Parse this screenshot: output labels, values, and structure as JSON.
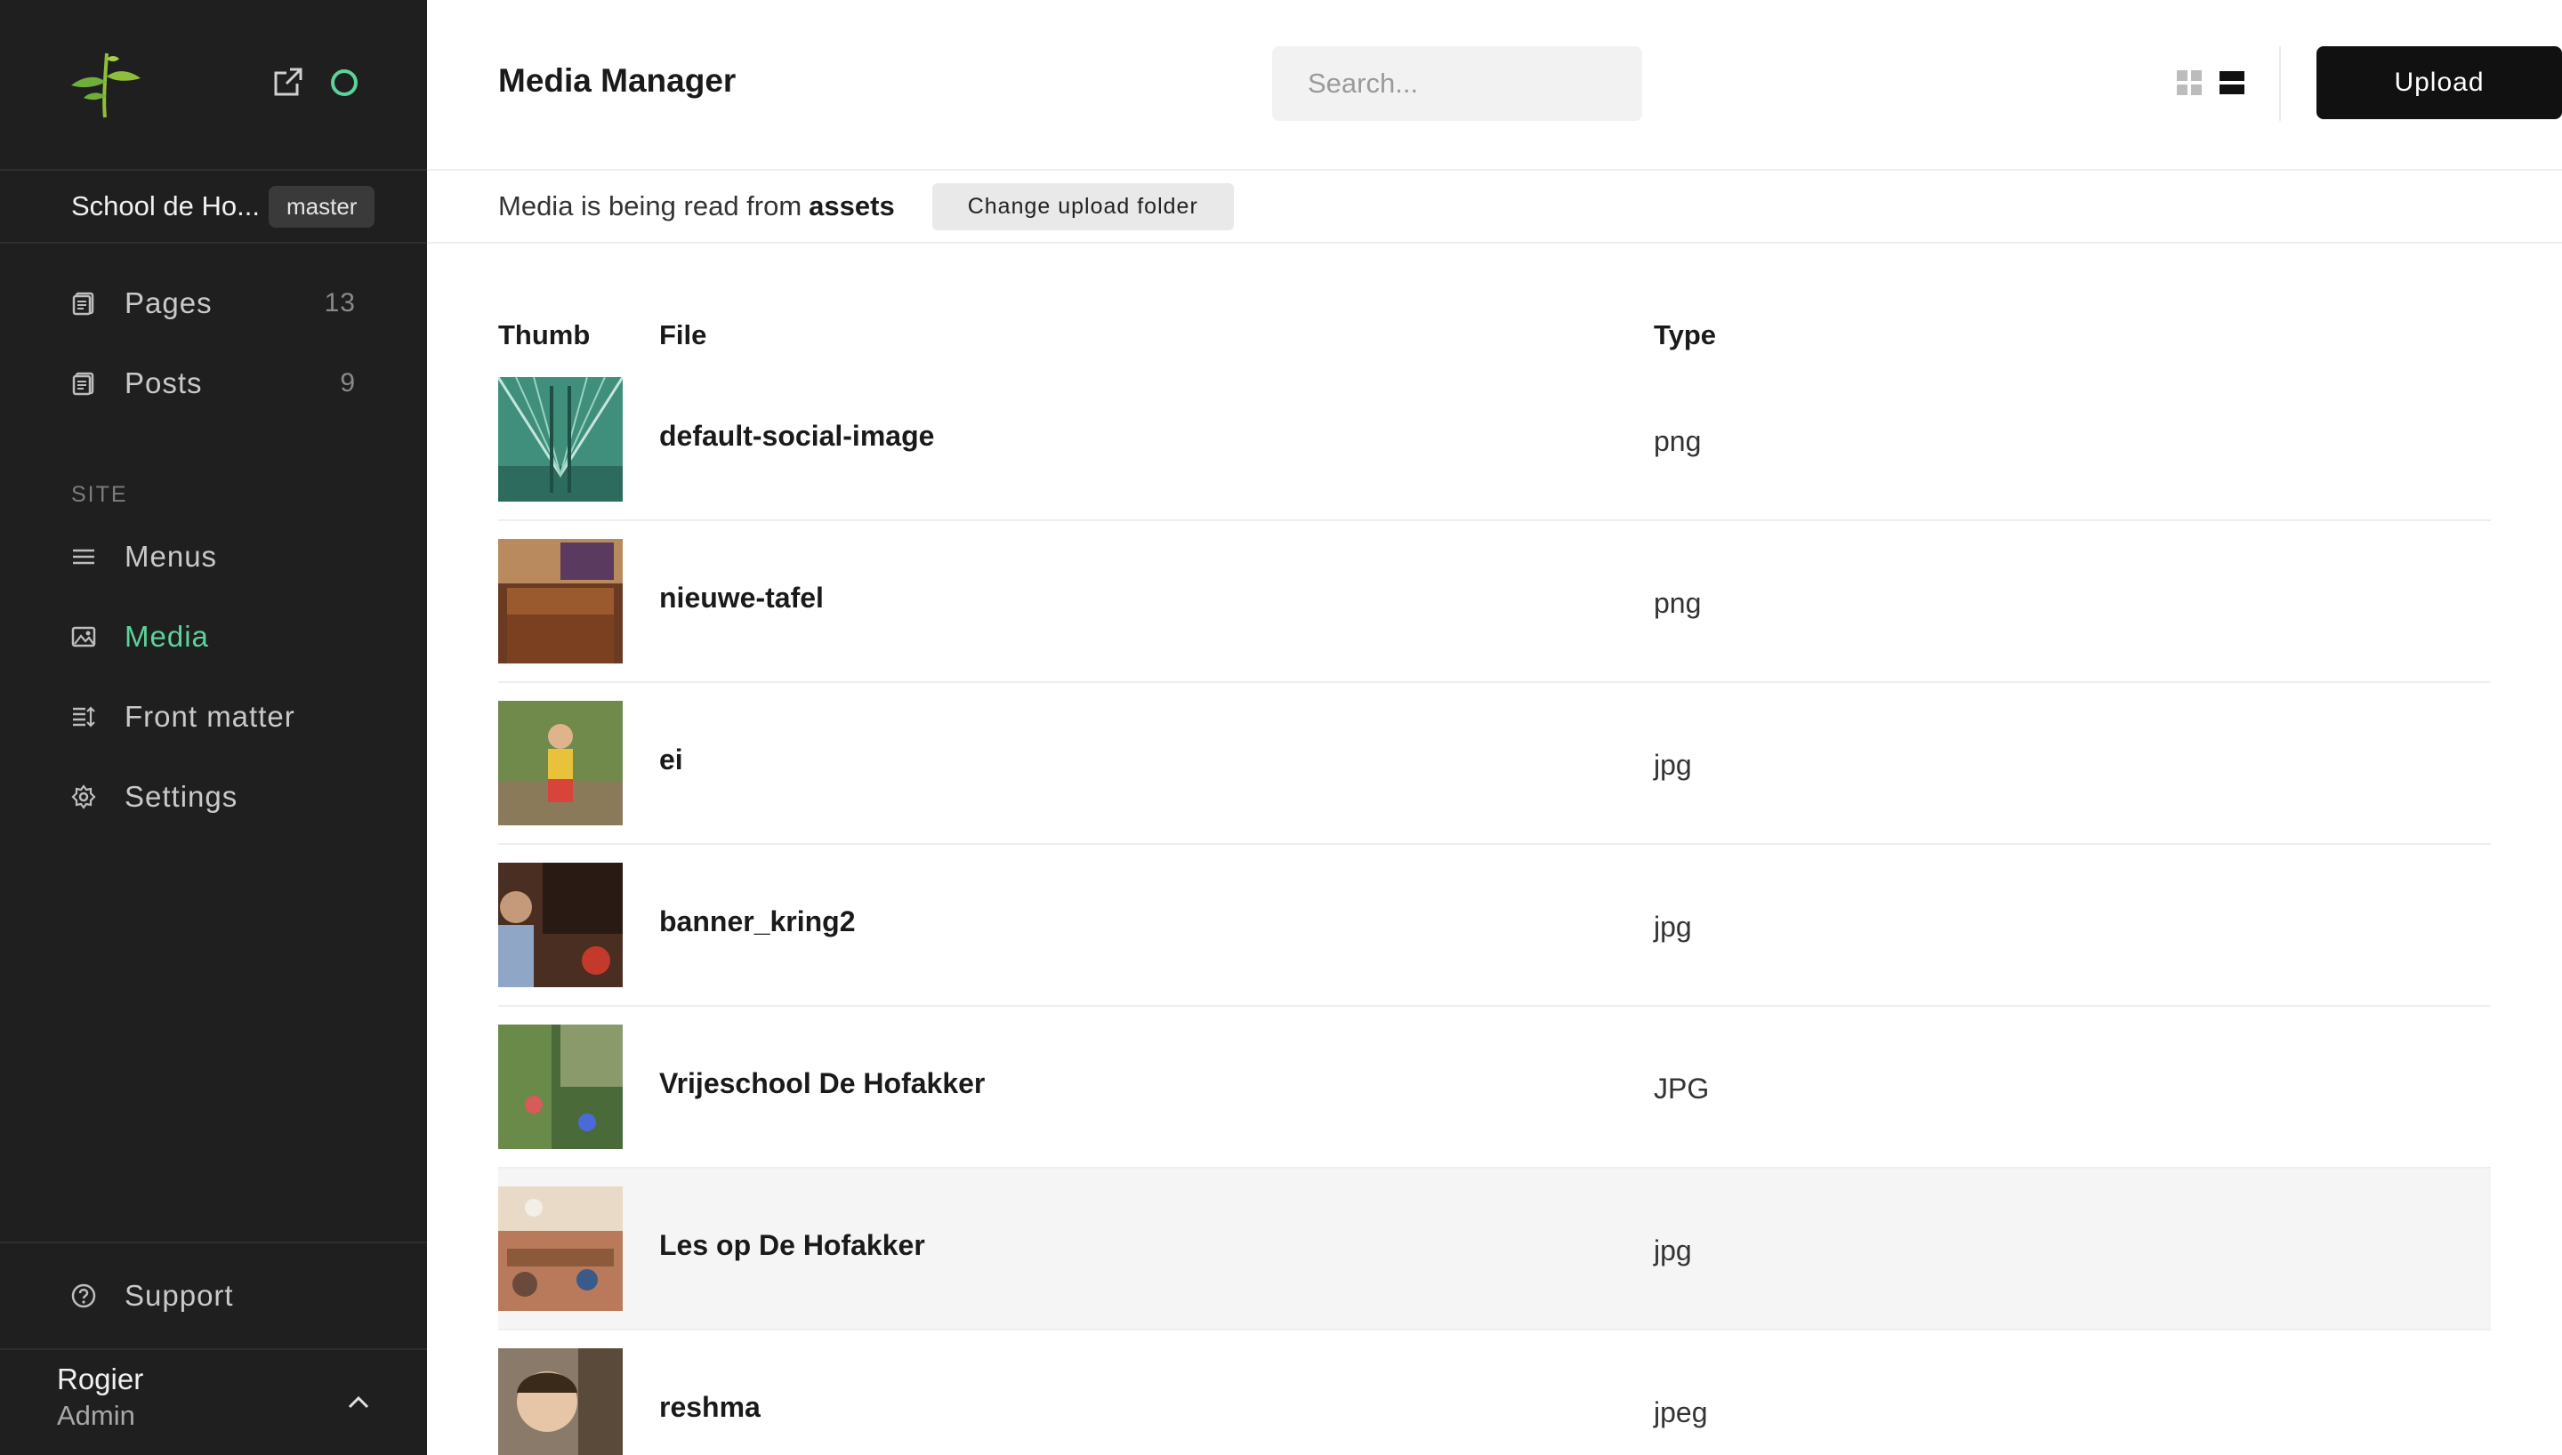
{
  "sidebar": {
    "site_name": "School de Ho...",
    "branch": "master",
    "nav_items": [
      {
        "label": "Pages",
        "count": "13"
      },
      {
        "label": "Posts",
        "count": "9"
      }
    ],
    "section_label": "SITE",
    "site_items": [
      {
        "label": "Menus",
        "icon": "menu-icon"
      },
      {
        "label": "Media",
        "icon": "image-icon",
        "active": true
      },
      {
        "label": "Front matter",
        "icon": "front-matter-icon"
      },
      {
        "label": "Settings",
        "icon": "gear-icon"
      }
    ],
    "support_label": "Support",
    "user": {
      "name": "Rogier",
      "role": "Admin"
    }
  },
  "header": {
    "title": "Media Manager",
    "search_placeholder": "Search...",
    "upload_label": "Upload"
  },
  "infobar": {
    "text": "Media is being read from",
    "folder": "assets",
    "change_label": "Change upload folder"
  },
  "table": {
    "columns": [
      "Thumb",
      "File",
      "Type"
    ],
    "rows": [
      {
        "file": "default-social-image",
        "type": "png"
      },
      {
        "file": "nieuwe-tafel",
        "type": "png"
      },
      {
        "file": "ei",
        "type": "jpg"
      },
      {
        "file": "banner_kring2",
        "type": "jpg"
      },
      {
        "file": "Vrijeschool De Hofakker",
        "type": "JPG"
      },
      {
        "file": "Les op De Hofakker",
        "type": "jpg"
      },
      {
        "file": "reshma",
        "type": "jpeg"
      }
    ]
  },
  "colors": {
    "accent": "#5bd39a",
    "sidebar_bg": "#1f1f1f",
    "button_bg": "#111111"
  }
}
